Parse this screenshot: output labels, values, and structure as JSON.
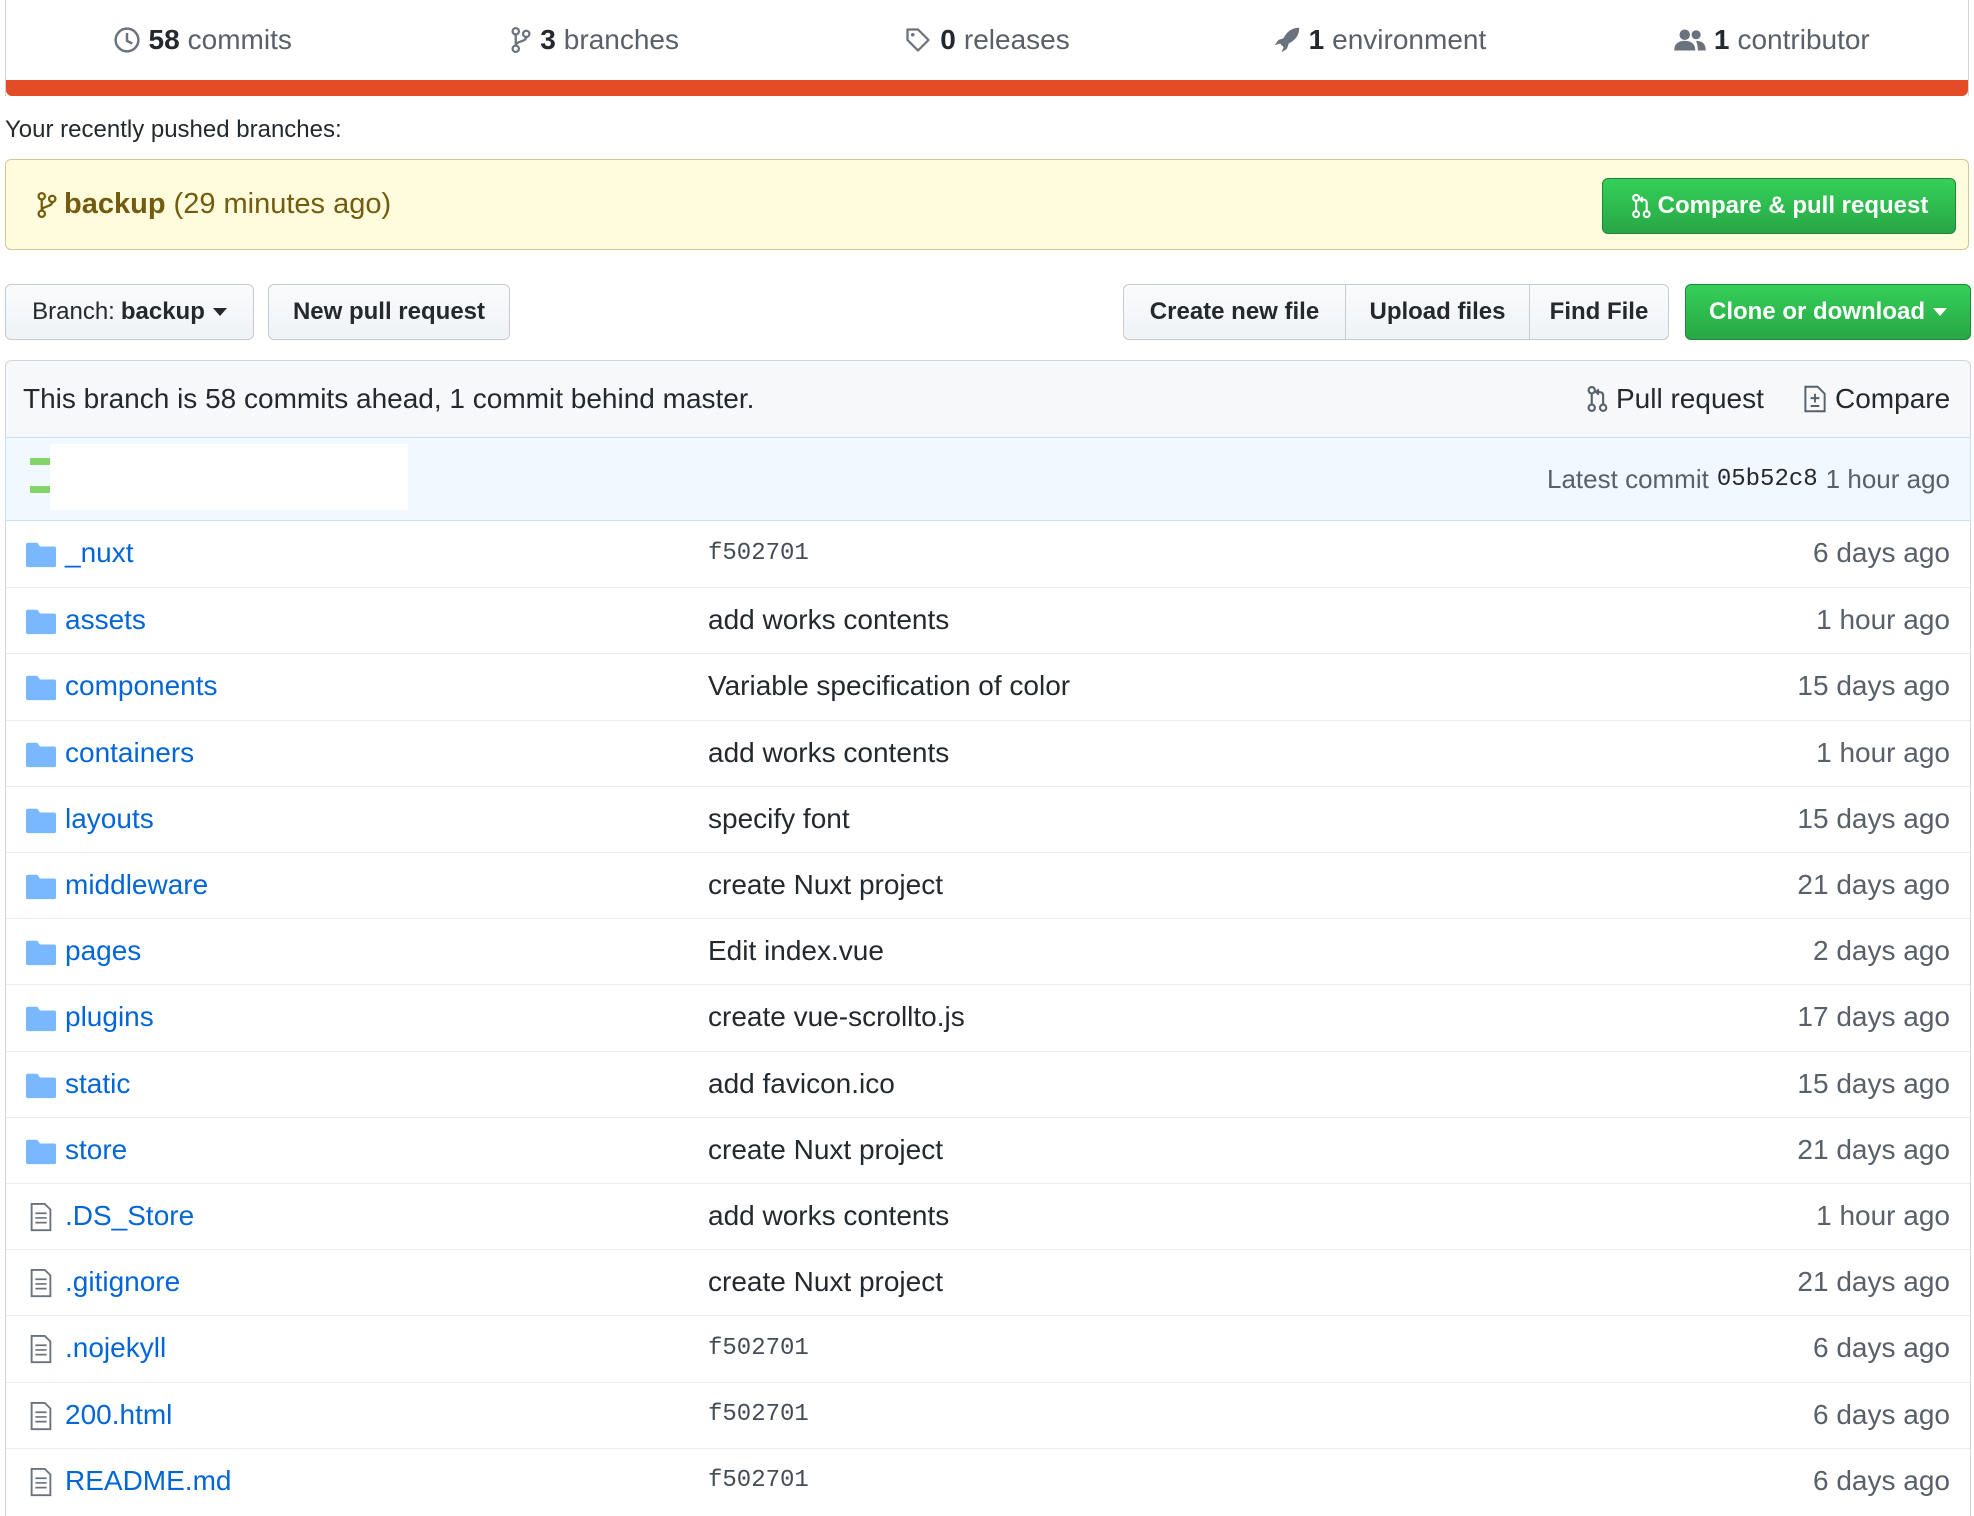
{
  "summary": {
    "commits": {
      "count": "58",
      "label": "commits"
    },
    "branches": {
      "count": "3",
      "label": "branches"
    },
    "releases": {
      "count": "0",
      "label": "releases"
    },
    "environment": {
      "count": "1",
      "label": "environment"
    },
    "contributors": {
      "count": "1",
      "label": "contributor"
    },
    "language_bar_color": "#e34c26"
  },
  "recent": {
    "label": "Your recently pushed branches:",
    "branch_name": "backup",
    "time": "(29 minutes ago)",
    "compare_button": "Compare & pull request"
  },
  "toolbar": {
    "branch_prefix": "Branch:",
    "branch_name": "backup",
    "new_pr": "New pull request",
    "create_file": "Create new file",
    "upload_files": "Upload files",
    "find_file": "Find File",
    "clone": "Clone or download"
  },
  "branch_info": {
    "text": "This branch is 58 commits ahead, 1 commit behind master.",
    "pull_request": "Pull request",
    "compare": "Compare"
  },
  "latest_commit": {
    "label": "Latest commit",
    "sha": "05b52c8",
    "time": "1 hour ago"
  },
  "files": [
    {
      "name": "_nuxt",
      "type": "folder",
      "message": "f502701",
      "mono": true,
      "age": "6 days ago"
    },
    {
      "name": "assets",
      "type": "folder",
      "message": "add works contents",
      "mono": false,
      "age": "1 hour ago"
    },
    {
      "name": "components",
      "type": "folder",
      "message": "Variable specification of color",
      "mono": false,
      "age": "15 days ago"
    },
    {
      "name": "containers",
      "type": "folder",
      "message": "add works contents",
      "mono": false,
      "age": "1 hour ago"
    },
    {
      "name": "layouts",
      "type": "folder",
      "message": "specify font",
      "mono": false,
      "age": "15 days ago"
    },
    {
      "name": "middleware",
      "type": "folder",
      "message": "create Nuxt project",
      "mono": false,
      "age": "21 days ago"
    },
    {
      "name": "pages",
      "type": "folder",
      "message": "Edit index.vue",
      "mono": false,
      "age": "2 days ago"
    },
    {
      "name": "plugins",
      "type": "folder",
      "message": "create vue-scrollto.js",
      "mono": false,
      "age": "17 days ago"
    },
    {
      "name": "static",
      "type": "folder",
      "message": "add favicon.ico",
      "mono": false,
      "age": "15 days ago"
    },
    {
      "name": "store",
      "type": "folder",
      "message": "create Nuxt project",
      "mono": false,
      "age": "21 days ago"
    },
    {
      "name": ".DS_Store",
      "type": "file",
      "message": "add works contents",
      "mono": false,
      "age": "1 hour ago"
    },
    {
      "name": ".gitignore",
      "type": "file",
      "message": "create Nuxt project",
      "mono": false,
      "age": "21 days ago"
    },
    {
      "name": ".nojekyll",
      "type": "file",
      "message": "f502701",
      "mono": true,
      "age": "6 days ago"
    },
    {
      "name": "200.html",
      "type": "file",
      "message": "f502701",
      "mono": true,
      "age": "6 days ago"
    },
    {
      "name": "README.md",
      "type": "file",
      "message": "f502701",
      "mono": true,
      "age": "6 days ago"
    }
  ]
}
